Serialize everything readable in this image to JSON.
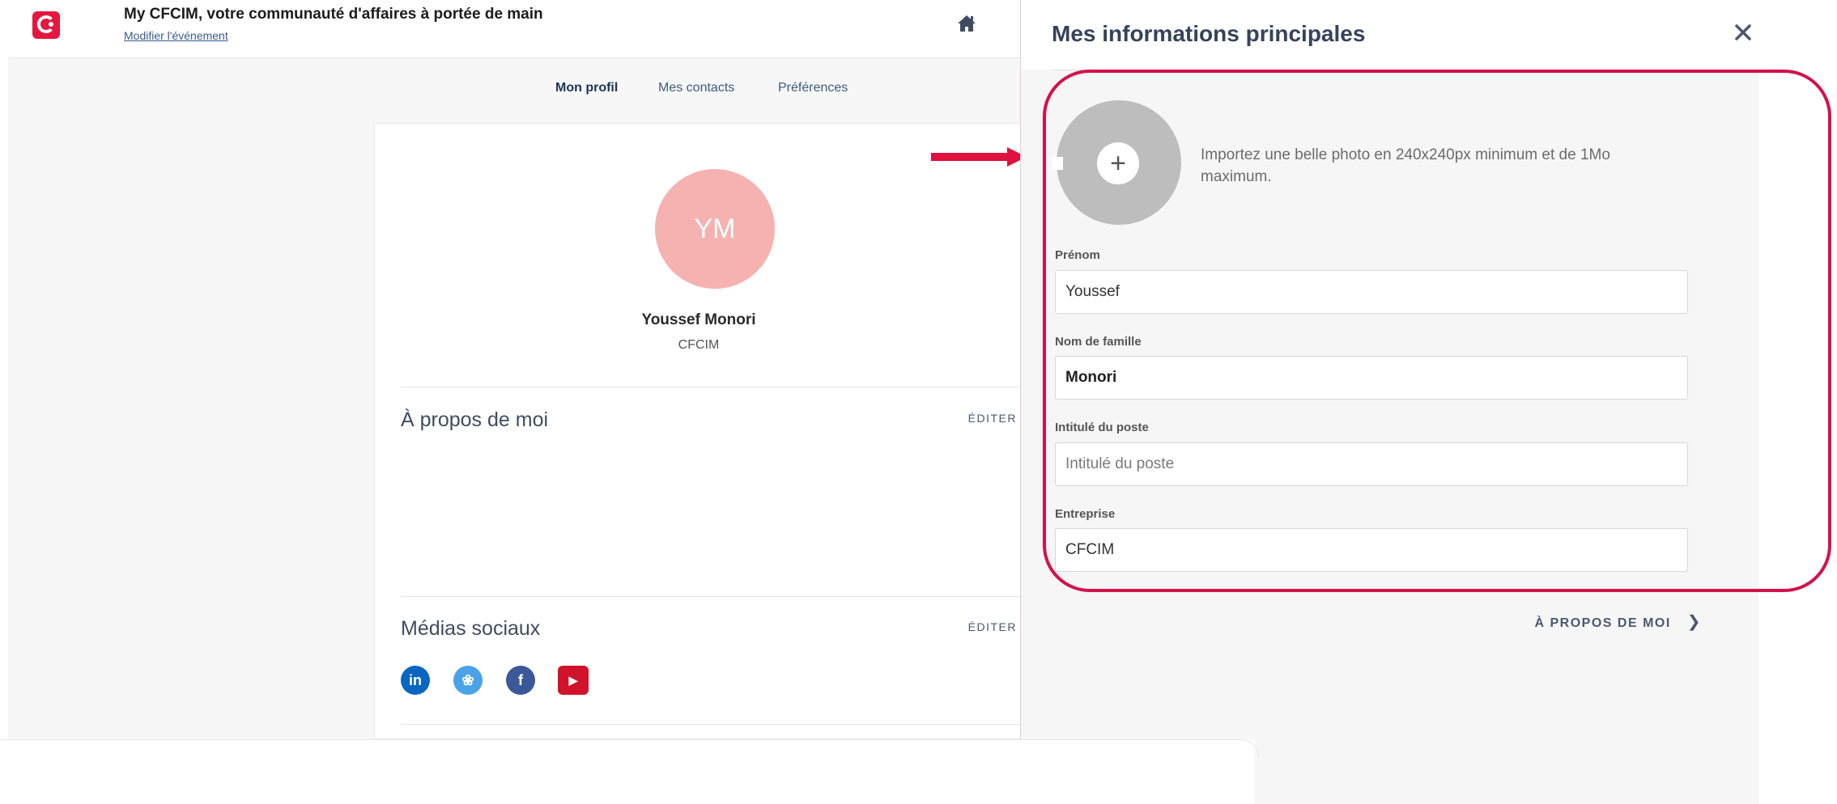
{
  "header": {
    "app_title": "My CFCIM, votre communauté d'affaires à portée de main",
    "edit_event": "Modifier l'événement",
    "brand_color": "#e5173f"
  },
  "tabs": [
    {
      "label": "Mon profil",
      "active": true
    },
    {
      "label": "Mes contacts",
      "active": false
    },
    {
      "label": "Préférences",
      "active": false
    }
  ],
  "profile": {
    "initials": "YM",
    "name": "Youssef  Monori",
    "company": "CFCIM",
    "avatar_color": "#f5b2b0"
  },
  "sections": {
    "about_title": "À propos de moi",
    "about_edit": "ÉDITER",
    "social_title": "Médias sociaux",
    "social_edit": "ÉDITER"
  },
  "social_icons": [
    {
      "icon": "linkedin-icon",
      "glyph": "in",
      "color": "#0a66c2"
    },
    {
      "icon": "twitter-icon",
      "glyph": "❀",
      "color": "#4aa3e8"
    },
    {
      "icon": "facebook-icon",
      "glyph": "f",
      "color": "#3b5998"
    },
    {
      "icon": "youtube-icon",
      "glyph": "▶",
      "color": "#d1122b"
    }
  ],
  "panel": {
    "title": "Mes informations principales",
    "close_icon": "close-icon",
    "photo_hint": "Importez une belle photo en 240x240px minimum et de 1Mo maximum.",
    "fields": {
      "first_name_label": "Prénom",
      "first_name_value": "Youssef",
      "last_name_label": "Nom de famille",
      "last_name_value": "Monori",
      "job_title_label": "Intitulé du poste",
      "job_title_placeholder": "Intitulé du poste",
      "company_label": "Entreprise",
      "company_value": "CFCIM"
    },
    "next_link": "À PROPOS DE MOI",
    "highlight_color": "#d3124a"
  }
}
